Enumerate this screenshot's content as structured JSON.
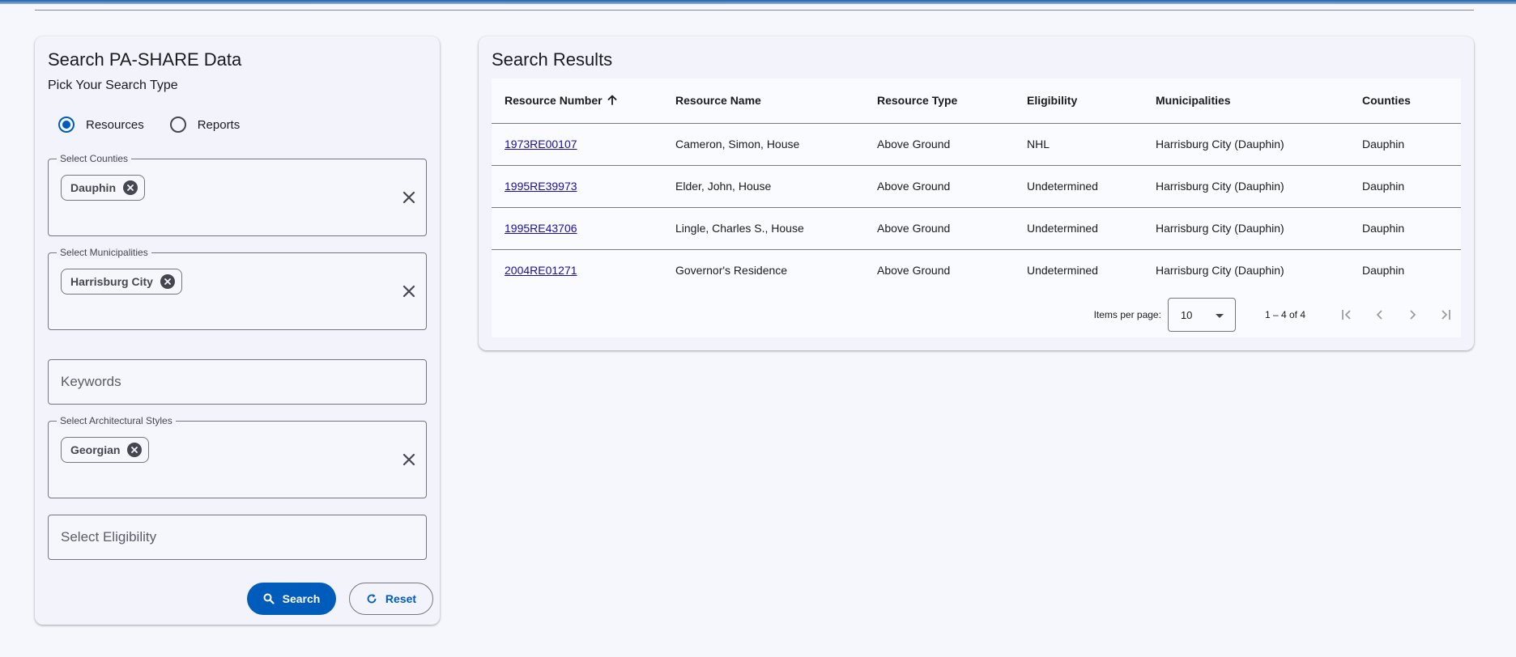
{
  "search": {
    "title": "Search PA-SHARE Data",
    "subtitle": "Pick Your Search Type",
    "search_types": [
      {
        "label": "Resources",
        "selected": true
      },
      {
        "label": "Reports",
        "selected": false
      }
    ],
    "counties": {
      "label": "Select Counties",
      "chips": [
        "Dauphin"
      ]
    },
    "municipalities": {
      "label": "Select Municipalities",
      "chips": [
        "Harrisburg City"
      ]
    },
    "keywords": {
      "placeholder": "Keywords",
      "value": ""
    },
    "architectural_styles": {
      "label": "Select Architectural Styles",
      "chips": [
        "Georgian"
      ]
    },
    "eligibility": {
      "placeholder": "Select Eligibility",
      "value": ""
    },
    "search_button": "Search",
    "reset_button": "Reset"
  },
  "results": {
    "title": "Search Results",
    "columns": [
      "Resource Number",
      "Resource Name",
      "Resource Type",
      "Eligibility",
      "Municipalities",
      "Counties"
    ],
    "sort": {
      "column": "Resource Number",
      "direction": "asc"
    },
    "rows": [
      [
        "1973RE00107",
        "Cameron, Simon, House",
        "Above Ground",
        "NHL",
        "Harrisburg City (Dauphin)",
        "Dauphin"
      ],
      [
        "1995RE39973",
        "Elder, John, House",
        "Above Ground",
        "Undetermined",
        "Harrisburg City (Dauphin)",
        "Dauphin"
      ],
      [
        "1995RE43706",
        "Lingle, Charles S., House",
        "Above Ground",
        "Undetermined",
        "Harrisburg City (Dauphin)",
        "Dauphin"
      ],
      [
        "2004RE01271",
        "Governor's Residence",
        "Above Ground",
        "Undetermined",
        "Harrisburg City (Dauphin)",
        "Dauphin"
      ]
    ],
    "paginator": {
      "items_per_page_label": "Items per page:",
      "items_per_page": "10",
      "range_label": "1 – 4 of 4"
    }
  },
  "colors": {
    "primary": "#005cbb",
    "background": "#f6f7fd",
    "card": "#f2f3fb",
    "link": "#1a0dab"
  }
}
